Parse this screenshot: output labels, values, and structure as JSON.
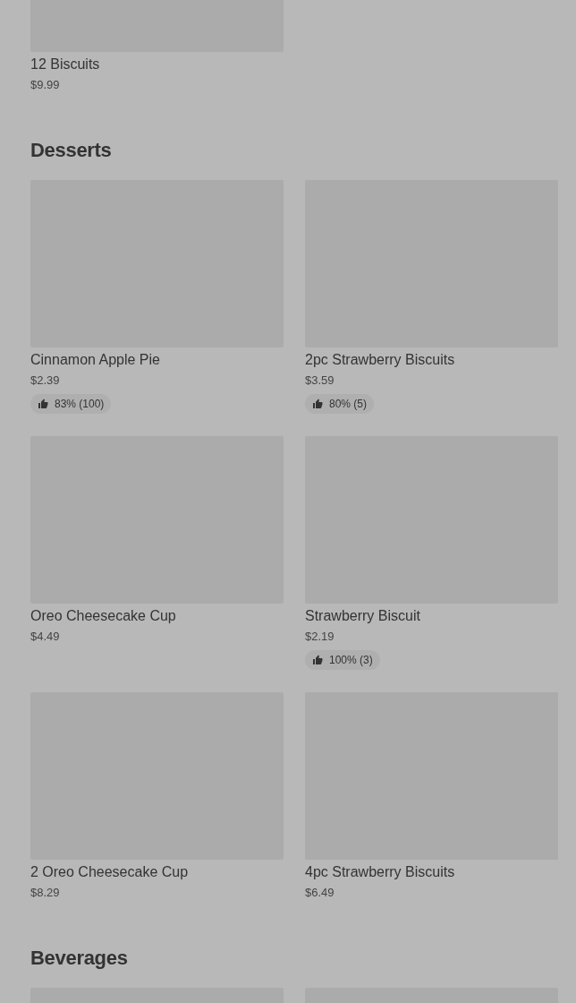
{
  "sections": [
    {
      "items": [
        {
          "kind": "product",
          "name": "12 Biscuits",
          "price": "$9.99"
        }
      ]
    },
    {
      "title": "Desserts",
      "items": [
        {
          "kind": "product",
          "name": "Cinnamon Apple Pie",
          "price": "$2.39",
          "rating": "83% (100)"
        },
        {
          "kind": "product",
          "name": "2pc Strawberry Biscuits",
          "price": "$3.59",
          "rating": "80% (5)"
        },
        {
          "kind": "product",
          "name": "Oreo Cheesecake Cup",
          "price": "$4.49"
        },
        {
          "kind": "product",
          "name": "Strawberry Biscuit",
          "price": "$2.19",
          "rating": "100% (3)"
        },
        {
          "kind": "product",
          "name": "2 Oreo Cheesecake Cup",
          "price": "$8.29"
        },
        {
          "kind": "product",
          "name": "4pc Strawberry Biscuits",
          "price": "$6.49"
        }
      ]
    },
    {
      "title": "Beverages"
    }
  ]
}
